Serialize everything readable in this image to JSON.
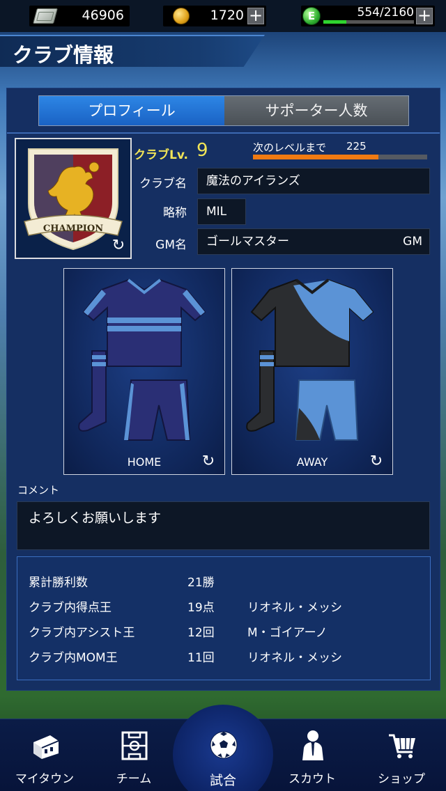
{
  "resources": {
    "cash": "46906",
    "coins": "1720",
    "stamina": "554/2160",
    "stamina_fraction": 0.256,
    "plus_label": "+",
    "stamina_icon_letter": "E"
  },
  "header": {
    "title": "クラブ情報"
  },
  "tabs": [
    {
      "label": "プロフィール",
      "active": true
    },
    {
      "label": "サポーター人数",
      "active": false
    }
  ],
  "club": {
    "emblem_text": "CHAMPION",
    "level_label": "クラブLv.",
    "level": "9",
    "next_level_label": "次のレベルまで",
    "next_level_value": "225",
    "exp_fraction": 0.72,
    "name_label": "クラブ名",
    "name": "魔法のアイランズ",
    "abbr_label": "略称",
    "abbr": "MIL",
    "gm_label": "GM名",
    "gm_name": "ゴールマスター",
    "gm_suffix": "GM"
  },
  "kits": {
    "home_label": "HOME",
    "away_label": "AWAY",
    "home_primary": "#2a2f75",
    "home_accent": "#5b93d6",
    "away_primary": "#2b2d30",
    "away_accent": "#5b93d6"
  },
  "comment": {
    "label": "コメント",
    "text": "よろしくお願いします"
  },
  "stats": [
    {
      "name": "累計勝利数",
      "value": "21勝",
      "player": ""
    },
    {
      "name": "クラブ内得点王",
      "value": "19点",
      "player": "リオネル・メッシ"
    },
    {
      "name": "クラブ内アシスト王",
      "value": "12回",
      "player": "M・ゴイアーノ"
    },
    {
      "name": "クラブ内MOM王",
      "value": "11回",
      "player": "リオネル・メッシ"
    }
  ],
  "nav": [
    {
      "label": "マイタウン",
      "icon": "town-icon"
    },
    {
      "label": "チーム",
      "icon": "pitch-icon"
    },
    {
      "label": "試合",
      "icon": "soccer-ball-icon"
    },
    {
      "label": "スカウト",
      "icon": "scout-icon"
    },
    {
      "label": "ショップ",
      "icon": "shopping-cart-icon"
    }
  ],
  "colors": {
    "accent_blue": "#2d86e5",
    "level_yellow": "#f1e457",
    "exp_orange": "#f07a12",
    "stamina_green": "#2fd22f"
  }
}
